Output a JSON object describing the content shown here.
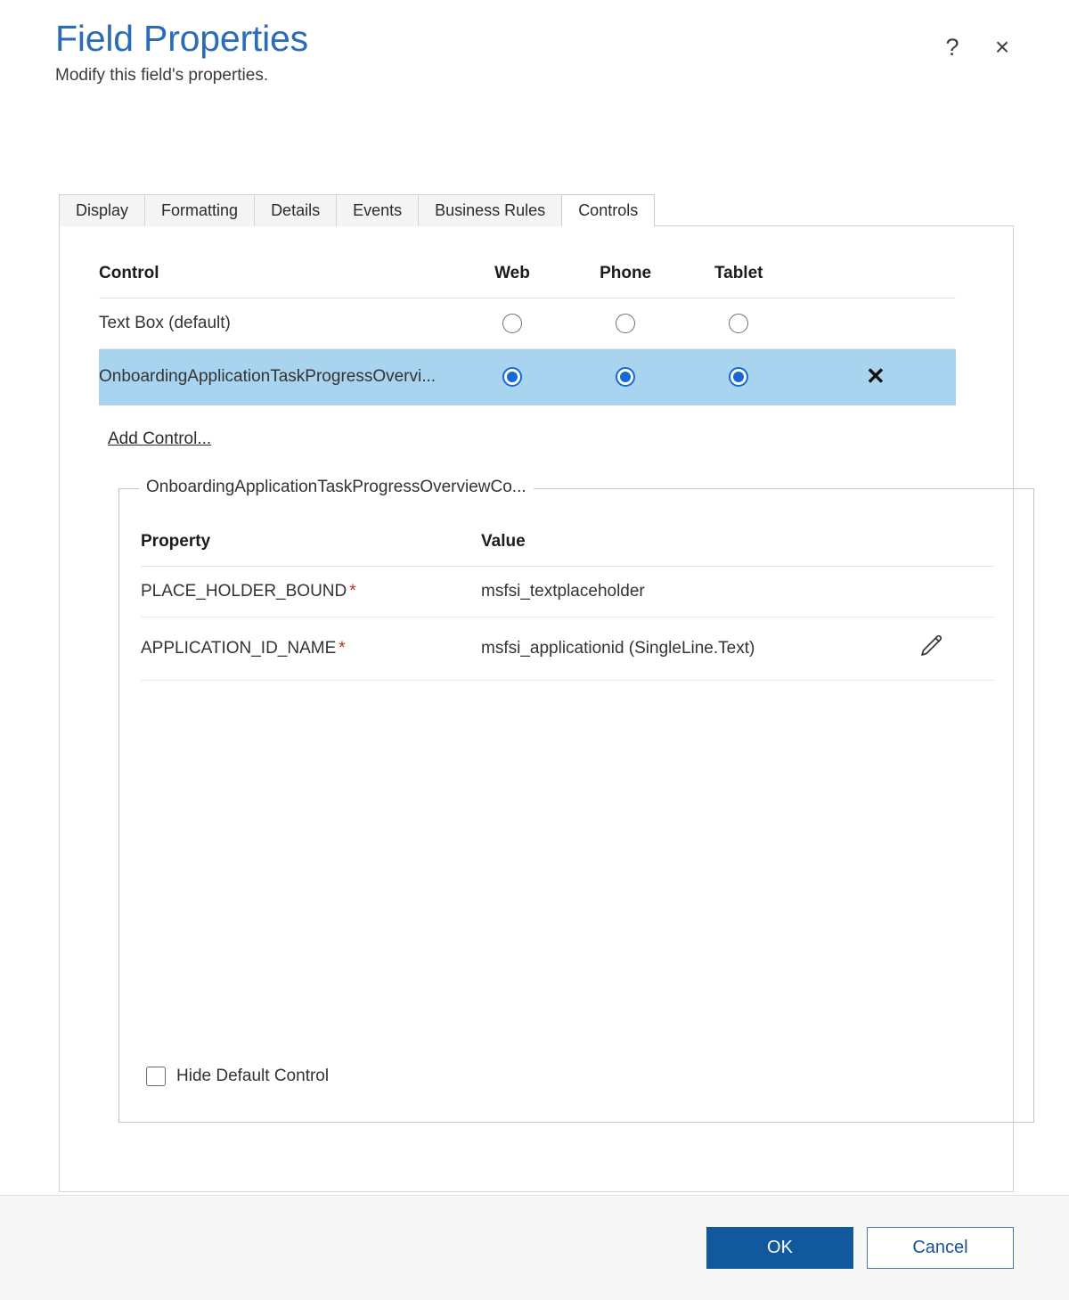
{
  "dialog": {
    "title": "Field Properties",
    "subtitle": "Modify this field's properties.",
    "help_icon": "?",
    "close_icon": "×"
  },
  "tabs": [
    {
      "label": "Display",
      "active": false
    },
    {
      "label": "Formatting",
      "active": false
    },
    {
      "label": "Details",
      "active": false
    },
    {
      "label": "Events",
      "active": false
    },
    {
      "label": "Business Rules",
      "active": false
    },
    {
      "label": "Controls",
      "active": true
    }
  ],
  "controls_table": {
    "headers": {
      "control": "Control",
      "web": "Web",
      "phone": "Phone",
      "tablet": "Tablet"
    },
    "rows": [
      {
        "name": "Text Box (default)",
        "web": false,
        "phone": false,
        "tablet": false,
        "selected": false,
        "removable": false
      },
      {
        "name": "OnboardingApplicationTaskProgressOvervi...",
        "web": true,
        "phone": true,
        "tablet": true,
        "selected": true,
        "removable": true,
        "remove_icon": "✕"
      }
    ],
    "add_control_link": "Add Control..."
  },
  "control_properties": {
    "legend": "OnboardingApplicationTaskProgressOverviewCo...",
    "headers": {
      "property": "Property",
      "value": "Value"
    },
    "rows": [
      {
        "property": "PLACE_HOLDER_BOUND",
        "required_marker": "*",
        "value": "msfsi_textplaceholder",
        "has_edit": false
      },
      {
        "property": "APPLICATION_ID_NAME",
        "required_marker": "*",
        "value": "msfsi_applicationid (SingleLine.Text)",
        "has_edit": true
      }
    ],
    "hide_default_control": {
      "label": "Hide Default Control",
      "checked": false
    }
  },
  "footer": {
    "ok_label": "OK",
    "cancel_label": "Cancel"
  },
  "colors": {
    "title_blue": "#2b6cb8",
    "selection_blue": "#a9d4ef",
    "radio_blue": "#1569d6",
    "primary_button": "#11589c",
    "required_red": "#c42b1c",
    "footer_bg": "#f7f7f7"
  }
}
